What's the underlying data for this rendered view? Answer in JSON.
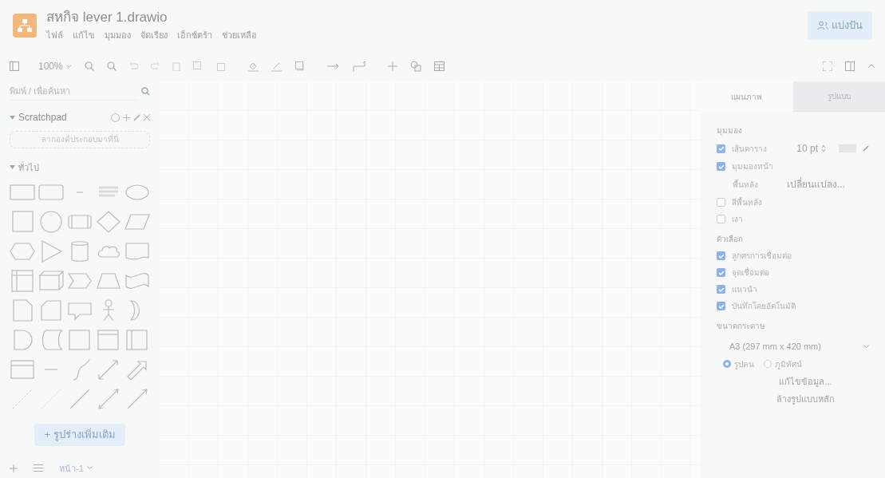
{
  "window": {
    "title": "สหกิจ lever 1.drawio"
  },
  "menu": [
    "ไฟล์",
    "แก้ไข",
    "มุมมอง",
    "จัดเรียง",
    "เอ็กซ์ตร้า",
    "ช่วยเหลือ"
  ],
  "share_button": "แบ่งปัน",
  "toolbar": {
    "zoom": "100%"
  },
  "sidebar": {
    "search": {
      "placeholder": "พิมพ์ / เพื่อค้นหา"
    },
    "scratchpad": {
      "title": "Scratchpad",
      "expanded": true,
      "drop_hint": "ลากองค์ประกอบมาที่นี่"
    },
    "general": {
      "title": "ทั่วไป",
      "expanded": true
    },
    "more_shapes": "+ รูปร่างเพิ่มเติม"
  },
  "bottom_bar": {
    "page_tab": "หน้า-1"
  },
  "format_panel": {
    "tabs": [
      {
        "label": "แผนภาพ",
        "selected": true
      },
      {
        "label": "รูปแบบ",
        "selected": false
      }
    ],
    "items": [
      {
        "kind": "heading",
        "label": "มุมมอง"
      },
      {
        "kind": "checkbox",
        "label": "เส้นตาราง",
        "checked": true,
        "value": "10 pt"
      },
      {
        "kind": "checkbox",
        "label": "มุมมองหน้า",
        "checked": true
      },
      {
        "kind": "button_row",
        "label": "พื้นหลัง",
        "button": "เปลี่ยนแปลง..."
      },
      {
        "kind": "checkbox",
        "label": "สีพื้นหลัง",
        "checked": false
      },
      {
        "kind": "checkbox",
        "label": "เงา",
        "checked": false
      },
      {
        "kind": "heading",
        "label": "ตัวเลือก"
      },
      {
        "kind": "checkbox",
        "label": "ลูกศรการเชื่อมต่อ",
        "checked": true
      },
      {
        "kind": "checkbox",
        "label": "จุดเชื่อมต่อ",
        "checked": true
      },
      {
        "kind": "checkbox",
        "label": "แนวนำ",
        "checked": true
      },
      {
        "kind": "checkbox",
        "label": "บันทึกโดยอัตโนมัติ",
        "checked": true
      },
      {
        "kind": "heading",
        "label": "ขนาดกระดาษ"
      },
      {
        "kind": "select",
        "value": "A3 (297 mm x 420 mm)"
      },
      {
        "kind": "radios",
        "options": [
          {
            "label": "รูปคน",
            "selected": true
          },
          {
            "label": "ภูมิทัศน์",
            "selected": false
          }
        ]
      },
      {
        "kind": "link",
        "label": "แก้ไขข้อมูล..."
      },
      {
        "kind": "link",
        "label": "ล้างรูปแบบหลัก"
      }
    ]
  }
}
